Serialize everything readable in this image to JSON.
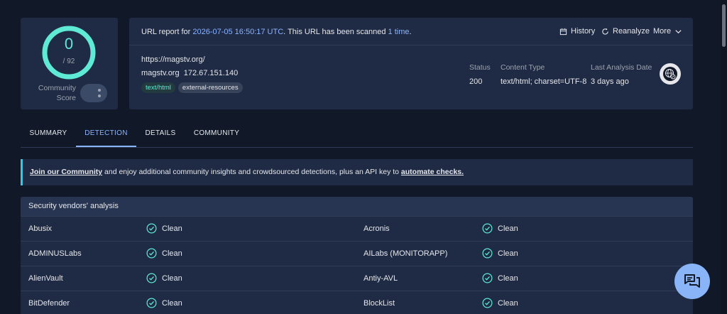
{
  "score": {
    "value": "0",
    "total": "/ 92",
    "community_label_1": "Community",
    "community_label_2": "Score"
  },
  "report": {
    "prefix": "URL report for ",
    "datetime": "2026-07-05 16:50:17 UTC",
    "middle": ". This URL has been scanned ",
    "scan_count": "1 time",
    "suffix": ".",
    "history_label": "History",
    "reanalyze_label": "Reanalyze",
    "more_label": "More",
    "url": "https://magstv.org/",
    "domain": "magstv.org",
    "ip": "172.67.151.140",
    "tags": [
      "text/html",
      "external-resources"
    ],
    "status_label": "Status",
    "status_value": "200",
    "content_type_label": "Content Type",
    "content_type_value": "text/html; charset=UTF-8",
    "last_analysis_label": "Last Analysis Date",
    "last_analysis_value": "3 days ago"
  },
  "tabs": [
    {
      "label": "SUMMARY"
    },
    {
      "label": "DETECTION"
    },
    {
      "label": "DETAILS"
    },
    {
      "label": "COMMUNITY"
    }
  ],
  "banner": {
    "link1": "Join our Community",
    "middle": " and enjoy additional community insights and crowdsourced detections, plus an API key to ",
    "link2": "automate checks."
  },
  "vendors": {
    "title": "Security vendors' analysis",
    "rows": [
      {
        "left_name": "Abusix",
        "left_status": "Clean",
        "right_name": "Acronis",
        "right_status": "Clean"
      },
      {
        "left_name": "ADMINUSLabs",
        "left_status": "Clean",
        "right_name": "AILabs (MONITORAPP)",
        "right_status": "Clean"
      },
      {
        "left_name": "AlienVault",
        "left_status": "Clean",
        "right_name": "Antiy-AVL",
        "right_status": "Clean"
      },
      {
        "left_name": "BitDefender",
        "left_status": "Clean",
        "right_name": "BlockList",
        "right_status": "Clean"
      }
    ]
  },
  "colors": {
    "accent": "#8ab4ff",
    "score_ring": "#5eead4",
    "banner_border": "#22d3ee",
    "clean_icon": "#5eead4"
  },
  "icons": {
    "history": "calendar-icon",
    "reanalyze": "refresh-icon",
    "more": "chevron-down-icon",
    "globe": "globe-link-icon",
    "clean": "check-circle-icon",
    "chat": "chat-icon"
  }
}
